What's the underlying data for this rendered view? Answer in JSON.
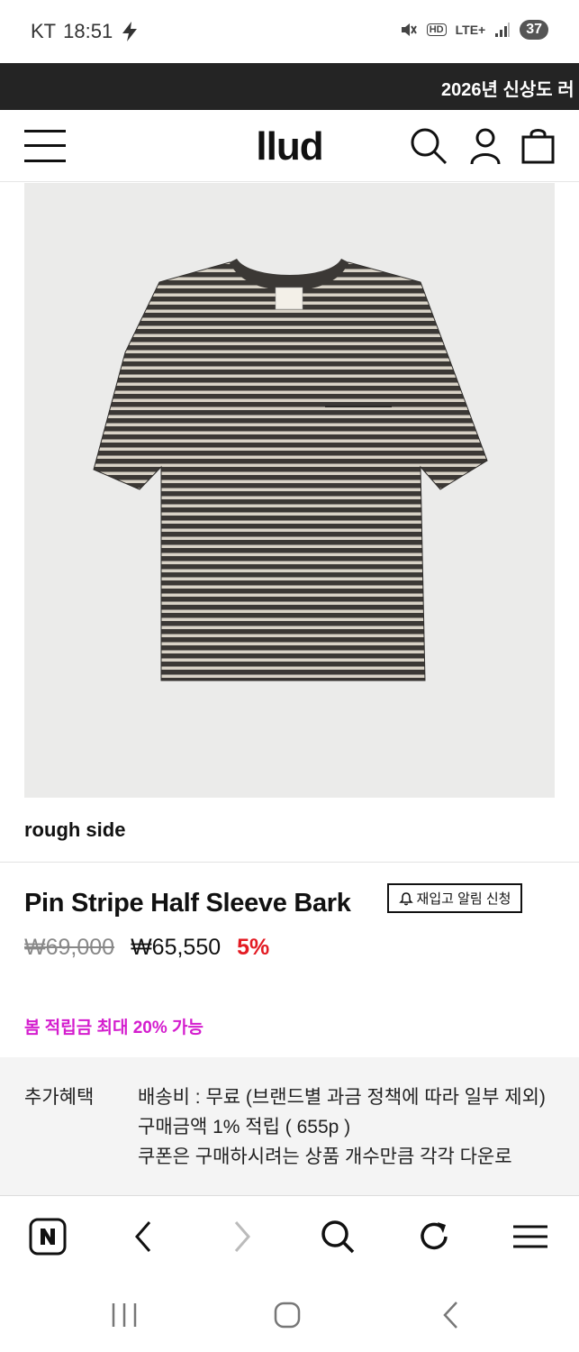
{
  "status_bar": {
    "carrier": "KT",
    "time": "18:51",
    "network": "LTE+",
    "hd": "HD",
    "battery": "37"
  },
  "banner": {
    "text": "2026년 신상도 러"
  },
  "header": {
    "logo": "llud",
    "icons": [
      "menu-icon",
      "search-icon",
      "user-icon",
      "bag-icon"
    ]
  },
  "product": {
    "image_label": "rough side",
    "brand": "rough side",
    "title": "Pin Stripe Half Sleeve Bark",
    "restock_label": "재입고 알림 신청",
    "original_price": "₩69,000",
    "sale_price": "₩65,550",
    "discount": "5%",
    "points_promo": "봄 적립금 최대 20% 가능"
  },
  "benefits": {
    "label": "추가혜택",
    "lines": [
      "배송비 : 무료 (브랜드별 과금 정책에 따라 일부 제외)",
      "구매금액 1% 적립 ( 655p )",
      "쿠폰은 구매하시려는 상품 개수만큼 각각 다운로"
    ]
  },
  "browser_bar": {
    "icons": [
      "naver-icon",
      "back-icon",
      "forward-icon",
      "search-icon",
      "refresh-icon",
      "menu-icon"
    ]
  },
  "system_nav": {
    "icons": [
      "recent-apps-icon",
      "home-icon",
      "back-icon"
    ]
  },
  "colors": {
    "banner_bg": "#242424",
    "discount": "#e31b23",
    "promo": "#d41dce",
    "image_bg": "#ebebea",
    "benefits_bg": "#f4f4f4"
  }
}
